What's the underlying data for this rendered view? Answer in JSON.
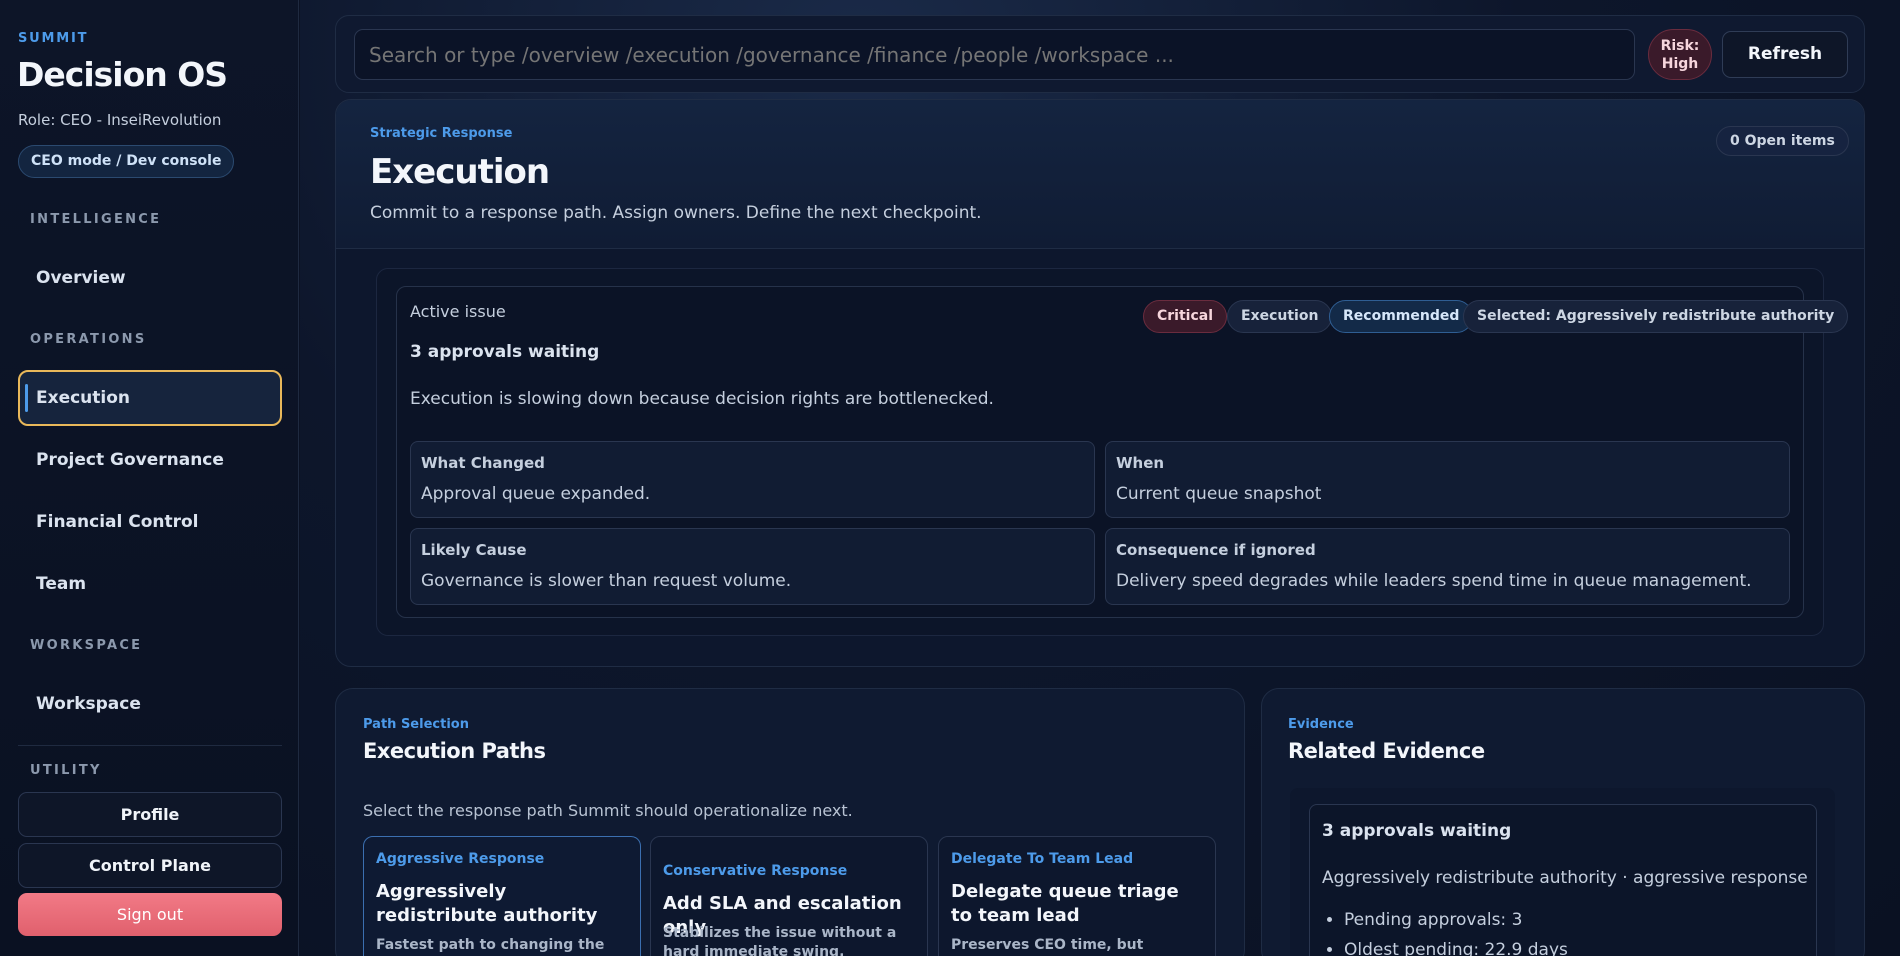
{
  "sidebar": {
    "kicker": "SUMMIT",
    "title": "Decision OS",
    "role": "Role: CEO - InseiRevolution",
    "mode": "CEO mode / Dev console",
    "sections": {
      "intelligence": "INTELLIGENCE",
      "operations": "OPERATIONS",
      "workspace": "WORKSPACE",
      "utility": "UTILITY"
    },
    "items": {
      "overview": "Overview",
      "execution": "Execution",
      "project_governance": "Project Governance",
      "financial_control": "Financial Control",
      "team": "Team",
      "workspace": "Workspace"
    },
    "utility": {
      "profile": "Profile",
      "control_plane": "Control Plane",
      "sign_out": "Sign out"
    }
  },
  "topbar": {
    "search_placeholder": "Search or type /overview /execution /governance /finance /people /workspace ...",
    "risk_line1": "Risk:",
    "risk_line2": "High",
    "refresh": "Refresh"
  },
  "hero": {
    "kicker": "Strategic Response",
    "title": "Execution",
    "subtitle": "Commit to a response path. Assign owners. Define the next checkpoint.",
    "open_items": "0 Open items"
  },
  "issue": {
    "label": "Active issue",
    "headline": "3 approvals waiting",
    "description": "Execution is slowing down because decision rights are bottlenecked.",
    "badges": {
      "critical": "Critical",
      "execution": "Execution",
      "recommended": "Recommended",
      "selected": "Selected: Aggressively redistribute authority"
    },
    "facts": {
      "what_changed_label": "What Changed",
      "what_changed_value": "Approval queue expanded.",
      "when_label": "When",
      "when_value": "Current queue snapshot",
      "likely_cause_label": "Likely Cause",
      "likely_cause_value": "Governance is slower than request volume.",
      "consequence_label": "Consequence if ignored",
      "consequence_value": "Delivery speed degrades while leaders spend time in queue management."
    }
  },
  "paths": {
    "kicker": "Path Selection",
    "title": "Execution Paths",
    "subtitle": "Select the response path Summit should operationalize next.",
    "cards": [
      {
        "kicker": "Aggressive Response",
        "title": "Aggressively redistribute authority",
        "desc": "Fastest path to changing the"
      },
      {
        "kicker": "Conservative Response",
        "title": "Add SLA and escalation only",
        "desc": "Stabilizes the issue without a hard immediate swing."
      },
      {
        "kicker": "Delegate To Team Lead",
        "title": "Delegate queue triage to team lead",
        "desc": "Preserves CEO time, but depends on"
      }
    ]
  },
  "evidence": {
    "kicker": "Evidence",
    "title": "Related Evidence",
    "card_title": "3 approvals waiting",
    "card_sub": "Aggressively redistribute authority · aggressive response",
    "items": [
      "Pending approvals: 3",
      "Oldest pending: 22.9 days"
    ]
  }
}
